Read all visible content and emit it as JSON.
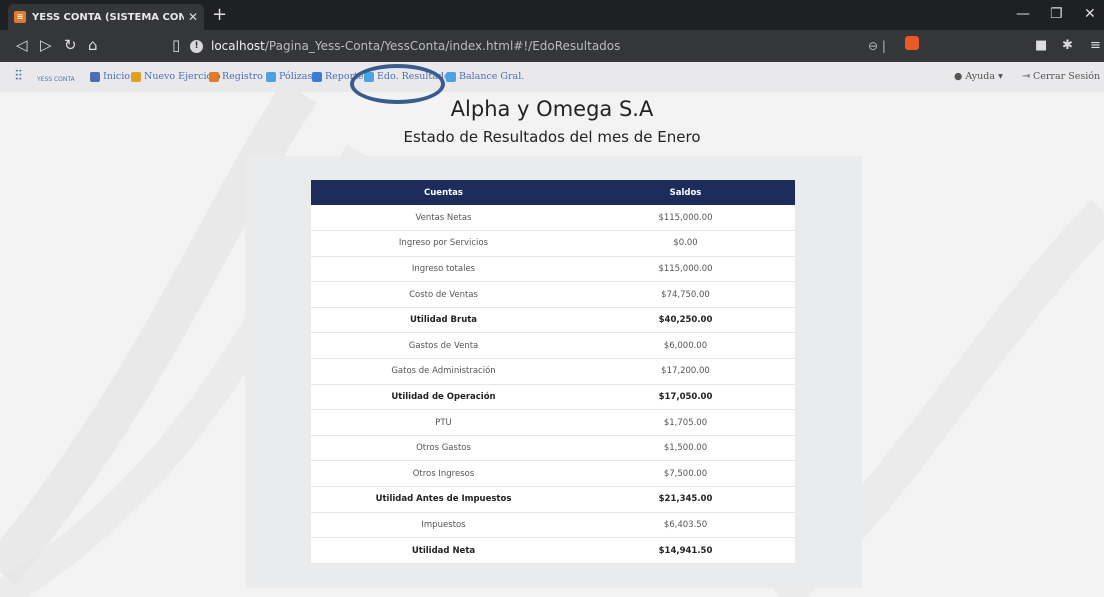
{
  "browser": {
    "tab_title": "YESS CONTA (SISTEMA CONTABL",
    "new_tab": "+",
    "url_host": "localhost",
    "url_path": "/Pagina_Yess-Conta/YessConta/index.html#!/EdoResultados"
  },
  "nav": {
    "logo_text": "YESS CONTA",
    "items": [
      {
        "label": "Inicio",
        "icon": "home-icon",
        "color": "#4a6fb5"
      },
      {
        "label": "Nuevo Ejercicio",
        "icon": "users-icon",
        "color": "#e0a020"
      },
      {
        "label": "Registro",
        "icon": "edit-icon",
        "color": "#e07b2a"
      },
      {
        "label": "Pólizas",
        "icon": "document-icon",
        "color": "#4aa3df"
      },
      {
        "label": "Reportes",
        "icon": "list-icon",
        "color": "#3a7bd5"
      },
      {
        "label": "Edo. Resultados",
        "icon": "document-icon",
        "color": "#4aa3df"
      },
      {
        "label": "Balance Gral.",
        "icon": "document-icon",
        "color": "#4aa3df"
      }
    ],
    "help": "Ayuda",
    "logout": "Cerrar Sesión"
  },
  "report": {
    "company": "Alpha y Omega S.A",
    "title": "Estado de Resultados del mes de Enero",
    "headers": {
      "account": "Cuentas",
      "balance": "Saldos"
    },
    "rows": [
      {
        "account": "Ventas Netas",
        "balance": "$115,000.00",
        "bold": false
      },
      {
        "account": "Ingreso por Servicios",
        "balance": "$0.00",
        "bold": false
      },
      {
        "account": "Ingreso totales",
        "balance": "$115,000.00",
        "bold": false
      },
      {
        "account": "Costo de Ventas",
        "balance": "$74,750.00",
        "bold": false
      },
      {
        "account": "Utilidad Bruta",
        "balance": "$40,250.00",
        "bold": true
      },
      {
        "account": "Gastos de Venta",
        "balance": "$6,000.00",
        "bold": false
      },
      {
        "account": "Gatos de Administración",
        "balance": "$17,200.00",
        "bold": false
      },
      {
        "account": "Utilidad de Operación",
        "balance": "$17,050.00",
        "bold": true
      },
      {
        "account": "PTU",
        "balance": "$1,705.00",
        "bold": false
      },
      {
        "account": "Otros Gastos",
        "balance": "$1,500.00",
        "bold": false
      },
      {
        "account": "Otros Ingresos",
        "balance": "$7,500.00",
        "bold": false
      },
      {
        "account": "Utilidad Antes de Impuestos",
        "balance": "$21,345.00",
        "bold": true
      },
      {
        "account": "Impuestos",
        "balance": "$6,403.50",
        "bold": false
      },
      {
        "account": "Utilidad Neta",
        "balance": "$14,941.50",
        "bold": true
      }
    ]
  }
}
